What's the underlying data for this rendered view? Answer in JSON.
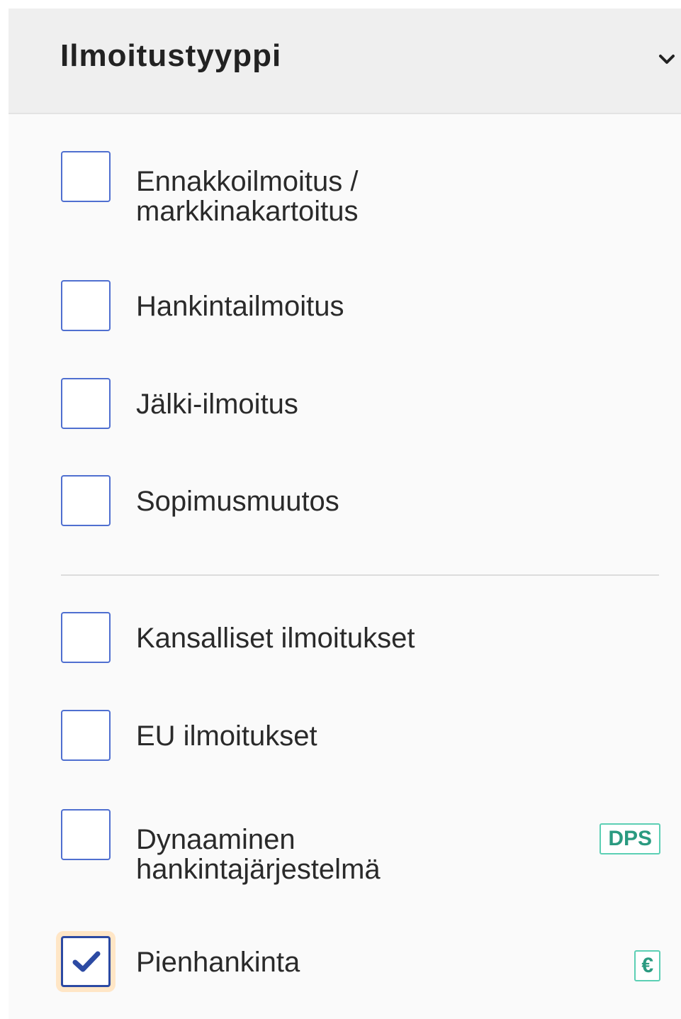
{
  "filter": {
    "title": "Ilmoitustyyppi",
    "expanded_icon": "chevron-down-icon"
  },
  "options": [
    {
      "label_line1": "Ennakkoilmoitus /",
      "label_line2": "markkinakartoitus",
      "checked": false
    },
    {
      "label": "Hankintailmoitus",
      "checked": false
    },
    {
      "label": "Jälki-ilmoitus",
      "checked": false
    },
    {
      "label": "Sopimusmuutos",
      "checked": false
    },
    {
      "label": "Kansalliset ilmoitukset",
      "checked": false
    },
    {
      "label": "EU ilmoitukset",
      "checked": false
    },
    {
      "label_line1": "Dynaaminen",
      "label_line2": "hankintajärjestelmä",
      "checked": false,
      "badge": "DPS"
    },
    {
      "label": "Pienhankinta",
      "checked": true,
      "badge": "€"
    }
  ],
  "colors": {
    "checkbox_border": "#4f6fd0",
    "checkmark": "#2c4aa3",
    "focus_ring": "#ffe6c6",
    "badge": "#5ccfb4"
  }
}
